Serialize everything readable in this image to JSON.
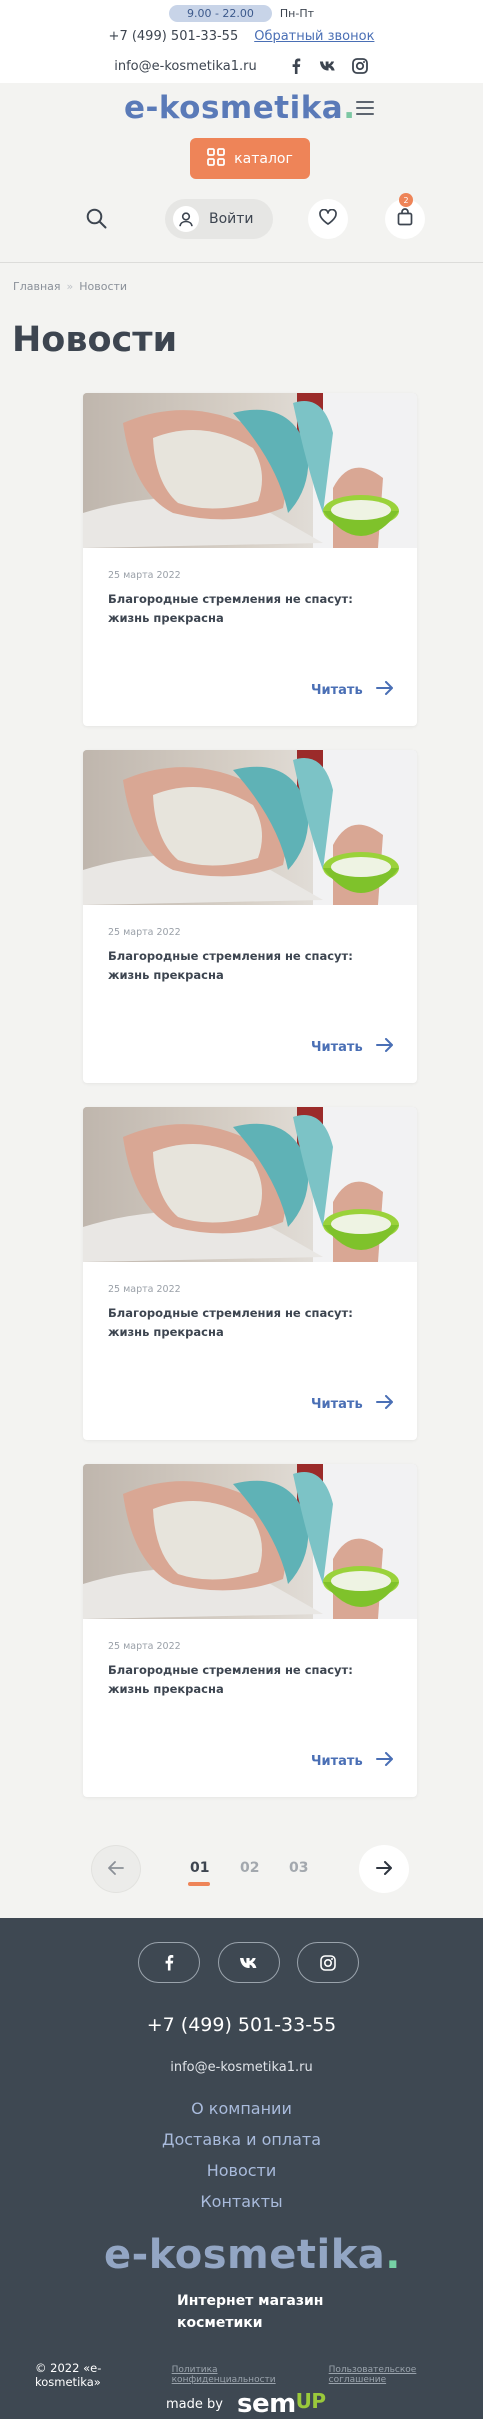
{
  "header": {
    "hours": "9.00 - 22.00",
    "days": "Пн-Пт",
    "phone": "+7 (499) 501-33-55",
    "callback_label": "Обратный звонок",
    "email": "info@e-kosmetika1.ru",
    "socials": [
      "facebook-icon",
      "vk-icon",
      "instagram-icon"
    ],
    "logo_text": "e-kosmetika",
    "logo_dot": ".",
    "catalog_label": "каталог",
    "login_label": "Войти",
    "cart_count": "2"
  },
  "breadcrumb": [
    "Главная",
    "Новости"
  ],
  "page_title": "Новости",
  "news": [
    {
      "date": "25 марта 2022",
      "title": "Благородные стремления не спасут: жизнь прекрасна",
      "read_label": "Читать"
    },
    {
      "date": "25 марта 2022",
      "title": "Благородные стремления не спасут: жизнь прекрасна",
      "read_label": "Читать"
    },
    {
      "date": "25 марта 2022",
      "title": "Благородные стремления не спасут: жизнь прекрасна",
      "read_label": "Читать"
    },
    {
      "date": "25 марта 2022",
      "title": "Благородные стремления не спасут: жизнь прекрасна",
      "read_label": "Читать"
    }
  ],
  "pagination": {
    "pages": [
      "01",
      "02",
      "03"
    ],
    "current": "01"
  },
  "footer": {
    "phone": "+7 (499) 501-33-55",
    "email": "info@e-kosmetika1.ru",
    "links": [
      "О компании",
      "Доставка и оплата",
      "Новости",
      "Контакты"
    ],
    "logo_text": "e-kosmetika",
    "logo_dot": ".",
    "tagline": "Интернет магазин косметики",
    "copyright": "© 2022 «e-kosmetika»",
    "privacy_label": "Политика конфиденциальности",
    "agreement_label": "Пользовательское соглашение",
    "made_by_label": "made by",
    "studio_main": "sem",
    "studio_accent": "UP"
  },
  "colors": {
    "accent_orange": "#ee8458",
    "brand_blue": "#5a7ab8",
    "link_blue": "#4a6fb5",
    "footer_bg": "#3e4852"
  }
}
